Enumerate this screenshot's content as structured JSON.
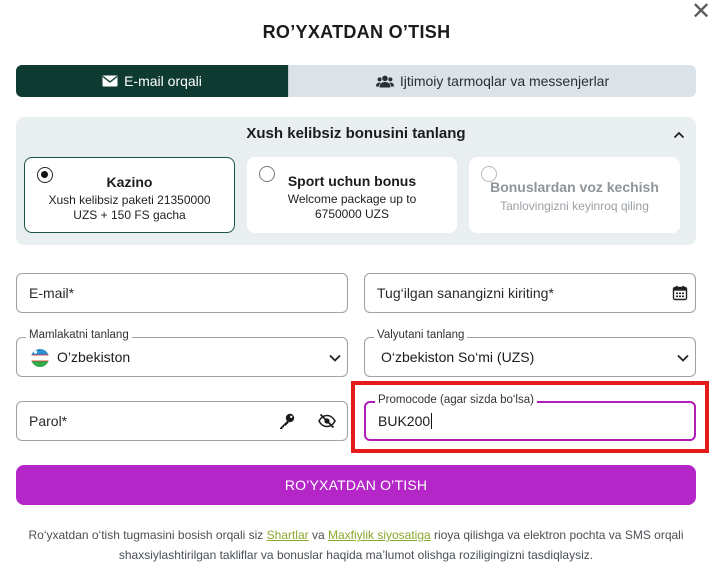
{
  "dialog": {
    "title": "RO’YXATDAN O’TISH",
    "close_glyph": "✕"
  },
  "tabs": [
    {
      "label": "E-mail orqali",
      "icon": "envelope-icon",
      "active": true
    },
    {
      "label": "Ijtimoiy tarmoqlar va messenjerlar",
      "icon": "users-icon",
      "active": false
    }
  ],
  "bonus": {
    "title": "Xush kelibsiz bonusini tanlang",
    "options": [
      {
        "name": "Kazino",
        "desc": "Xush kelibsiz paketi 21350000 UZS + 150 FS gacha",
        "selected": true
      },
      {
        "name": "Sport uchun bonus",
        "desc": "Welcome package up to 6750000 UZS",
        "selected": false
      },
      {
        "name": "Bonuslardan voz kechish",
        "desc": "Tanlovingizni keyinroq qiling",
        "selected": false
      }
    ]
  },
  "form": {
    "email_placeholder": "E-mail*",
    "birthdate_placeholder": "Tug‘ilgan sanangizni kiriting*",
    "country_label": "Mamlakatni tanlang",
    "country_value": "O’zbekiston",
    "currency_label": "Valyutani tanlang",
    "currency_value": "O‘zbekiston So‘mi (UZS)",
    "password_placeholder": "Parol*",
    "promo_label": "Promocode (agar sizda bo‘lsa)",
    "promo_value": "BUK200"
  },
  "submit_label": "RO’YXATDAN O’TISH",
  "footer": {
    "text_1": "Ro‘yxatdan o‘tish tugmasini bosish orqali siz ",
    "link_terms": "Shartlar",
    "text_2": " va ",
    "link_privacy": "Maxfiylik siyosatiga",
    "text_3": " rioya qilishga va elektron pochta va SMS orqali shaxsiylashtirilgan takliflar va bonuslar haqida ma’lumot olishga roziligingizni tasdiqlaysiz."
  },
  "colors": {
    "tab_active": "#0f3a31",
    "accent_purple": "#b526c9",
    "highlight_red": "#e51b1b",
    "link_green": "#8aa82d"
  }
}
